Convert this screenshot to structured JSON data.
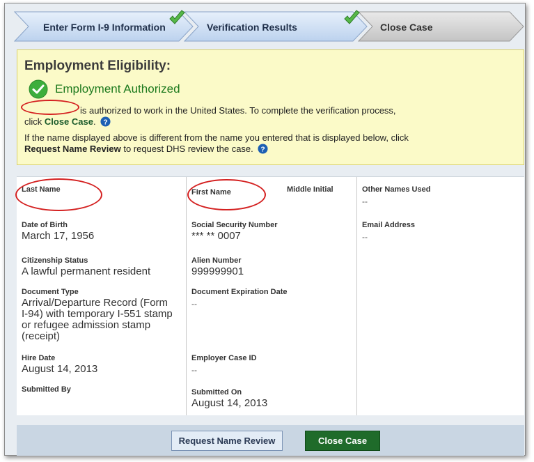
{
  "steps": [
    {
      "label": "Enter Form I-9 Information",
      "completed": true
    },
    {
      "label": "Verification Results",
      "completed": true
    },
    {
      "label": "Close Case",
      "completed": false
    }
  ],
  "eligibility": {
    "heading": "Employment Eligibility:",
    "status": "Employment Authorized",
    "authorized_text": "is authorized to work in the United States. To complete the verification process,",
    "click_prefix": "click ",
    "close_case_link": "Close Case",
    "close_case_suffix": ".",
    "name_diff_text": "If the name displayed above is different from the name you entered that is displayed below, click",
    "request_review_link": "Request Name Review",
    "request_review_suffix": " to request DHS review the case."
  },
  "details": {
    "last_name_label": "Last Name",
    "first_name_label": "First Name",
    "middle_initial_label": "Middle Initial",
    "other_names_label": "Other Names Used",
    "other_names_value": "--",
    "dob_label": "Date of Birth",
    "dob_value": "March 17, 1956",
    "ssn_label": "Social Security Number",
    "ssn_value": "*** ** 0007",
    "email_label": "Email Address",
    "email_value": "--",
    "citizenship_label": "Citizenship Status",
    "citizenship_value": "A lawful permanent resident",
    "alien_label": "Alien Number",
    "alien_value": "999999901",
    "doc_type_label": "Document Type",
    "doc_type_value_lines": [
      "Arrival/Departure Record (Form",
      "I-94) with temporary I-551 stamp",
      "or refugee admission stamp",
      "(receipt)"
    ],
    "doc_exp_label": "Document Expiration Date",
    "doc_exp_value": "--",
    "hire_date_label": "Hire Date",
    "hire_date_value": "August 14, 2013",
    "employer_case_label": "Employer Case ID",
    "employer_case_value": "--",
    "submitted_by_label": "Submitted By",
    "submitted_on_label": "Submitted On",
    "submitted_on_value": "August 14, 2013"
  },
  "buttons": {
    "request_review": "Request Name Review",
    "close_case": "Close Case"
  },
  "colors": {
    "success_green": "#3cae3c",
    "help_blue": "#1c5fb3",
    "callout_red": "#d42020",
    "notice_yellow": "#fbfac8",
    "close_button_green": "#1f6b2a"
  },
  "icons": {
    "completed_step": "checkmark-icon",
    "authorized": "check-circle-icon",
    "help": "question-circle-icon"
  }
}
